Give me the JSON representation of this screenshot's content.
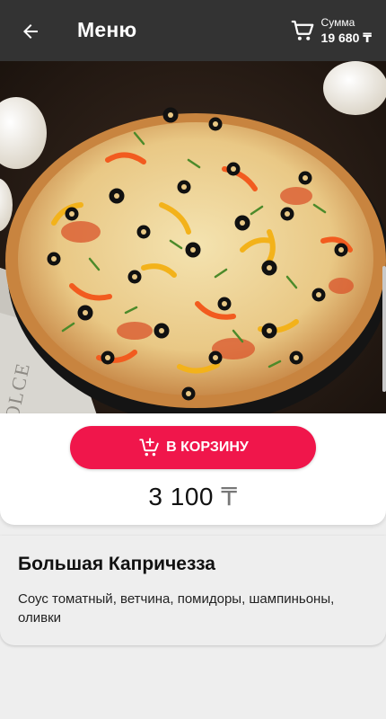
{
  "appbar": {
    "title": "Меню",
    "back_icon": "arrow-left-icon",
    "cart": {
      "icon": "cart-icon",
      "caption": "Сумма",
      "amount": "19 680 ₸"
    }
  },
  "product": {
    "name": "Большая Капричезза",
    "description": "Соус томатный, ветчина, помидоры, шампиньоны, оливки",
    "price_value": "3 100",
    "price_currency": "₸",
    "add_to_cart_label": "В КОРЗИНУ",
    "add_to_cart_icon": "cart-plus-icon",
    "image": "pizza-photo",
    "image_box_text": "DOLCE"
  },
  "colors": {
    "appbar": "#333333",
    "accent": "#f0164b",
    "background": "#eeeeee",
    "card": "#ffffff"
  }
}
